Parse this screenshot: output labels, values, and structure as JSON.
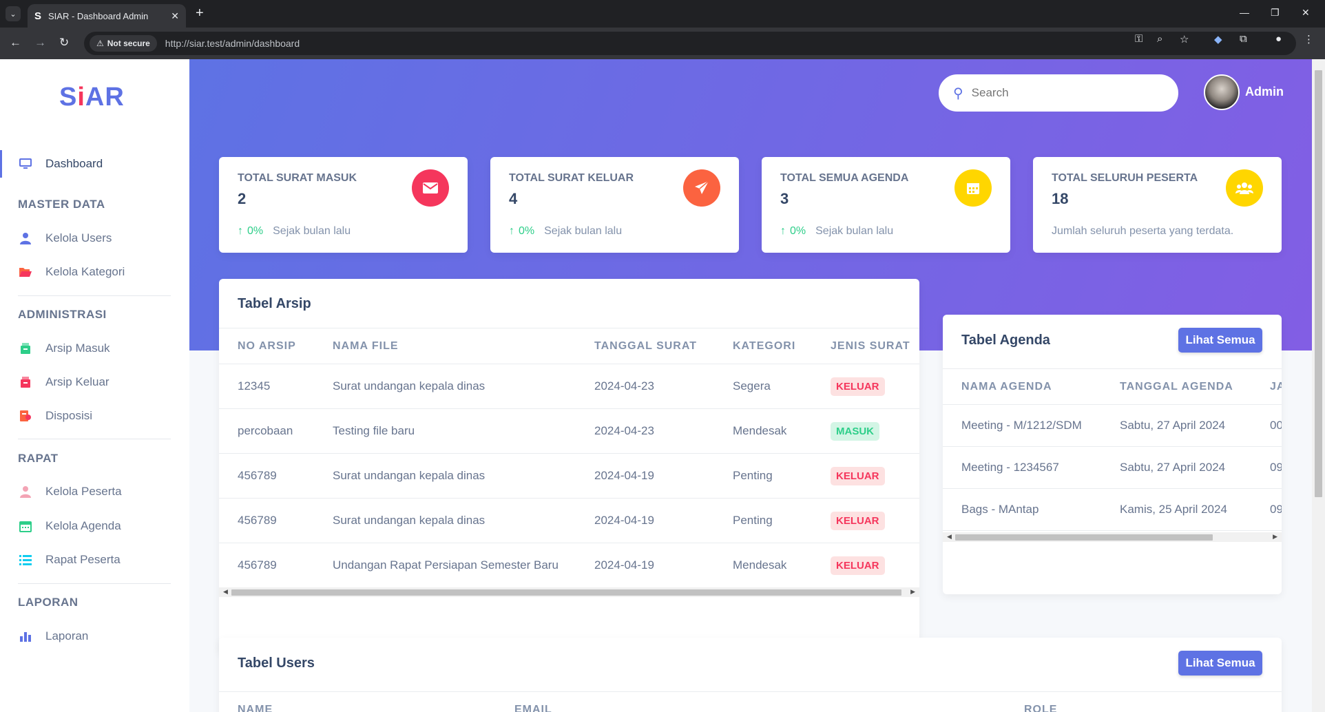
{
  "browser": {
    "tab_title": "SIAR - Dashboard Admin",
    "not_secure": "Not secure",
    "url": "http://siar.test/admin/dashboard"
  },
  "sidebar": {
    "logo_left": "S",
    "logo_i": "i",
    "logo_right": "AR",
    "dashboard": "Dashboard",
    "sections": {
      "master": "MASTER DATA",
      "admin": "ADMINISTRASI",
      "rapat": "RAPAT",
      "laporan": "LAPORAN"
    },
    "items": {
      "users": "Kelola Users",
      "kategori": "Kelola Kategori",
      "arsip_masuk": "Arsip Masuk",
      "arsip_keluar": "Arsip Keluar",
      "disposisi": "Disposisi",
      "peserta": "Kelola Peserta",
      "agenda": "Kelola Agenda",
      "rapat_peserta": "Rapat Peserta",
      "laporan": "Laporan"
    }
  },
  "header": {
    "search_placeholder": "Search",
    "user_name": "Admin"
  },
  "stats": [
    {
      "label": "TOTAL SURAT MASUK",
      "value": "2",
      "pct": "0%",
      "note": "Sejak bulan lalu",
      "color": "#f5365c"
    },
    {
      "label": "TOTAL SURAT KELUAR",
      "value": "4",
      "pct": "0%",
      "note": "Sejak bulan lalu",
      "color": "#fb6340"
    },
    {
      "label": "TOTAL SEMUA AGENDA",
      "value": "3",
      "pct": "0%",
      "note": "Sejak bulan lalu",
      "color": "#ffd600"
    },
    {
      "label": "TOTAL SELURUH PESERTA",
      "value": "18",
      "note": "Jumlah seluruh peserta yang terdata.",
      "color": "#ffd600"
    }
  ],
  "arsip": {
    "title": "Tabel Arsip",
    "headers": [
      "NO ARSIP",
      "NAMA FILE",
      "TANGGAL SURAT",
      "KATEGORI",
      "JENIS SURAT"
    ],
    "rows": [
      {
        "no": "12345",
        "file": "Surat undangan kepala dinas",
        "tanggal": "2024-04-23",
        "kategori": "Segera",
        "jenis": "KELUAR"
      },
      {
        "no": "percobaan",
        "file": "Testing file baru",
        "tanggal": "2024-04-23",
        "kategori": "Mendesak",
        "jenis": "MASUK"
      },
      {
        "no": "456789",
        "file": "Surat undangan kepala dinas",
        "tanggal": "2024-04-19",
        "kategori": "Penting",
        "jenis": "KELUAR"
      },
      {
        "no": "456789",
        "file": "Surat undangan kepala dinas",
        "tanggal": "2024-04-19",
        "kategori": "Penting",
        "jenis": "KELUAR"
      },
      {
        "no": "456789",
        "file": "Undangan Rapat Persiapan Semester Baru",
        "tanggal": "2024-04-19",
        "kategori": "Mendesak",
        "jenis": "KELUAR"
      }
    ]
  },
  "agenda": {
    "title": "Tabel Agenda",
    "button": "Lihat Semua",
    "headers": [
      "NAMA AGENDA",
      "TANGGAL AGENDA",
      "JA"
    ],
    "rows": [
      {
        "nama": "Meeting - M/1212/SDM",
        "tanggal": "Sabtu, 27 April 2024",
        "jam": "00"
      },
      {
        "nama": "Meeting - 1234567",
        "tanggal": "Sabtu, 27 April 2024",
        "jam": "09"
      },
      {
        "nama": "Bags - MAntap",
        "tanggal": "Kamis, 25 April 2024",
        "jam": "09"
      }
    ]
  },
  "users": {
    "title": "Tabel Users",
    "button": "Lihat Semua",
    "headers": [
      "NAME",
      "EMAIL",
      "ROLE"
    ]
  }
}
